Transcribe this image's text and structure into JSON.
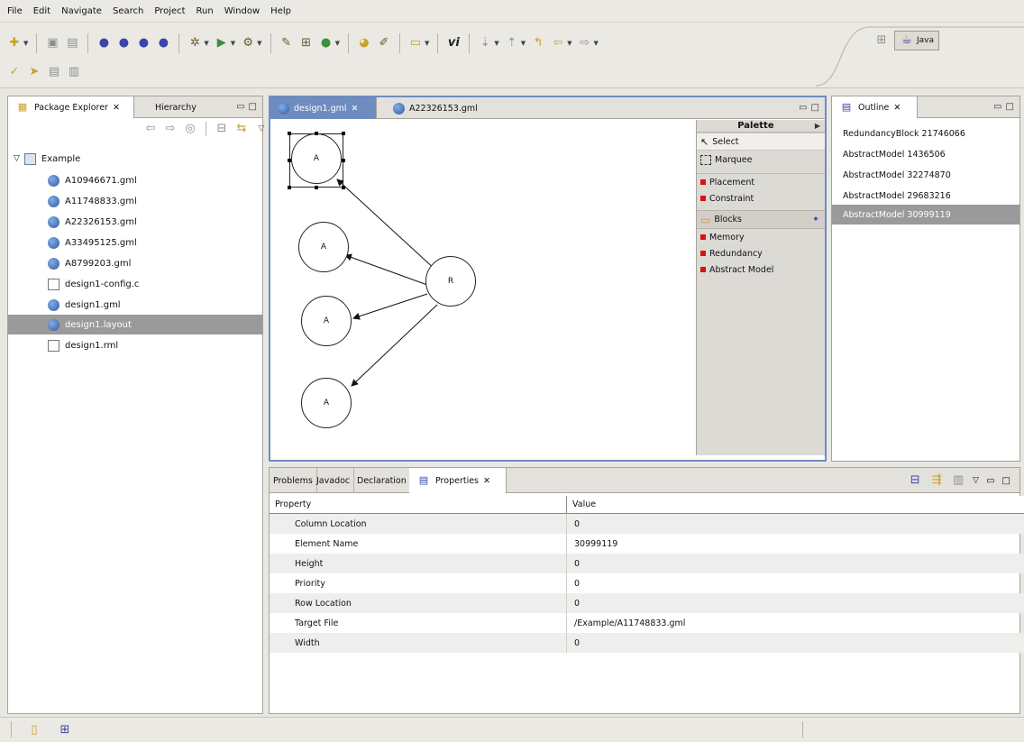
{
  "menu": [
    "File",
    "Edit",
    "Navigate",
    "Search",
    "Project",
    "Run",
    "Window",
    "Help"
  ],
  "perspective": {
    "label": "Java"
  },
  "package_explorer": {
    "tabs": [
      "Package Explorer",
      "Hierarchy"
    ],
    "project": "Example",
    "files": [
      "A10946671.gml",
      "A11748833.gml",
      "A22326153.gml",
      "A33495125.gml",
      "A8799203.gml",
      "design1-config.c",
      "design1.gml",
      "design1.layout",
      "design1.rml"
    ],
    "selected": "design1.layout"
  },
  "editor": {
    "tabs": [
      "design1.gml",
      "A22326153.gml"
    ],
    "nodes": [
      "A",
      "A",
      "A",
      "A",
      "R"
    ]
  },
  "palette": {
    "title": "Palette",
    "tools": [
      "Select",
      "Marquee"
    ],
    "items": [
      "Placement",
      "Constraint"
    ],
    "drawer": "Blocks",
    "blocks": [
      "Memory",
      "Redundancy",
      "Abstract Model"
    ]
  },
  "outline": {
    "tab": "Outline",
    "items": [
      "RedundancyBlock 21746066",
      "AbstractModel 1436506",
      "AbstractModel 32274870",
      "AbstractModel 29683216",
      "AbstractModel 30999119"
    ],
    "selected": "AbstractModel 30999119"
  },
  "bottom": {
    "tabs": [
      "Problems",
      "Javadoc",
      "Declaration",
      "Properties"
    ],
    "headers": [
      "Property",
      "Value"
    ],
    "rows": [
      [
        "Column Location",
        "0"
      ],
      [
        "Element Name",
        "30999119"
      ],
      [
        "Height",
        "0"
      ],
      [
        "Priority",
        "0"
      ],
      [
        "Row Location",
        "0"
      ],
      [
        "Target File",
        "/Example/A11748833.gml"
      ],
      [
        "Width",
        "0"
      ]
    ]
  },
  "colors": {
    "selection": "#9a9a9a",
    "editor_tab_active": "#6e8cc0",
    "palette_marker": "#d9120e"
  }
}
